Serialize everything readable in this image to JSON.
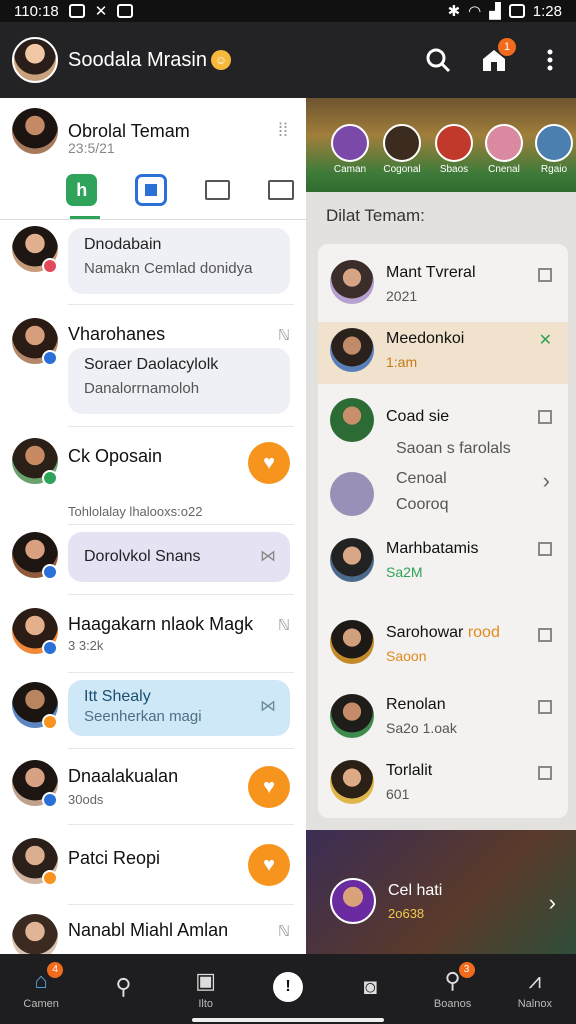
{
  "status_bar": {
    "time": "110:18",
    "right_text": "1:28"
  },
  "app_bar": {
    "title": "Soodala Mrasin",
    "notification_badge": "1"
  },
  "left_panel": {
    "header": {
      "name": "Obrolal Temam",
      "sub": "23:5/21"
    },
    "chats": [
      {
        "bubble_line1": "Dnodabain",
        "bubble_line2": "Namakn Cemlad donidya"
      },
      {
        "name": "Vharohanes",
        "bubble_line1": "Soraer Daolacylolk",
        "bubble_line2": "Danalorrnamoloh"
      },
      {
        "name": "Ck Oposain",
        "meta": "Tohlolalay lhalooxs:o22"
      },
      {
        "bubble_line1": "Dorolvkol Snans"
      },
      {
        "name": "Haagakarn nlaok Magk",
        "meta": "3 3:2k"
      },
      {
        "bubble_line1": "Itt Shealy",
        "bubble_line2": "Seenherkan magi"
      },
      {
        "name": "Dnaalakualan",
        "meta": "30ods"
      },
      {
        "name": "Patci Reopi"
      },
      {
        "name": "Nanabl Miahl Amlan"
      }
    ]
  },
  "right_panel": {
    "stories": [
      "Caman",
      "Cogonal",
      "Sbaos",
      "Cnenal",
      "Rgaio"
    ],
    "section_title": "Dilat Temam:",
    "items": [
      {
        "title": "Mant Tvreral",
        "sub": "2021"
      },
      {
        "title": "Meedonkoi",
        "sub": "1:am"
      },
      {
        "title": "Coad sie",
        "line2": "Saoan s farolals",
        "line3": "Cenoal",
        "line4": "Cooroq"
      },
      {
        "title": "Marhbatamis",
        "sub": "Sa2M"
      },
      {
        "title": "Sarohowar",
        "title_suffix": "rood",
        "sub": "Saoon"
      },
      {
        "title": "Renolan",
        "sub": "Sa2o 1.oak"
      },
      {
        "title": "Torlalit",
        "sub": "601"
      }
    ],
    "promo": {
      "title": "Cel hati",
      "sub": "2o638"
    }
  },
  "bottom_nav": [
    {
      "label": "Camen",
      "badge": "4"
    },
    {
      "label": ""
    },
    {
      "label": "Ilto"
    },
    {
      "label": ""
    },
    {
      "label": ""
    },
    {
      "label": "Boanos",
      "badge": "3"
    },
    {
      "label": "Nalnox"
    }
  ],
  "colors": {
    "accent_orange": "#f7941e",
    "green": "#2fa35a",
    "blue": "#2a70d6"
  }
}
